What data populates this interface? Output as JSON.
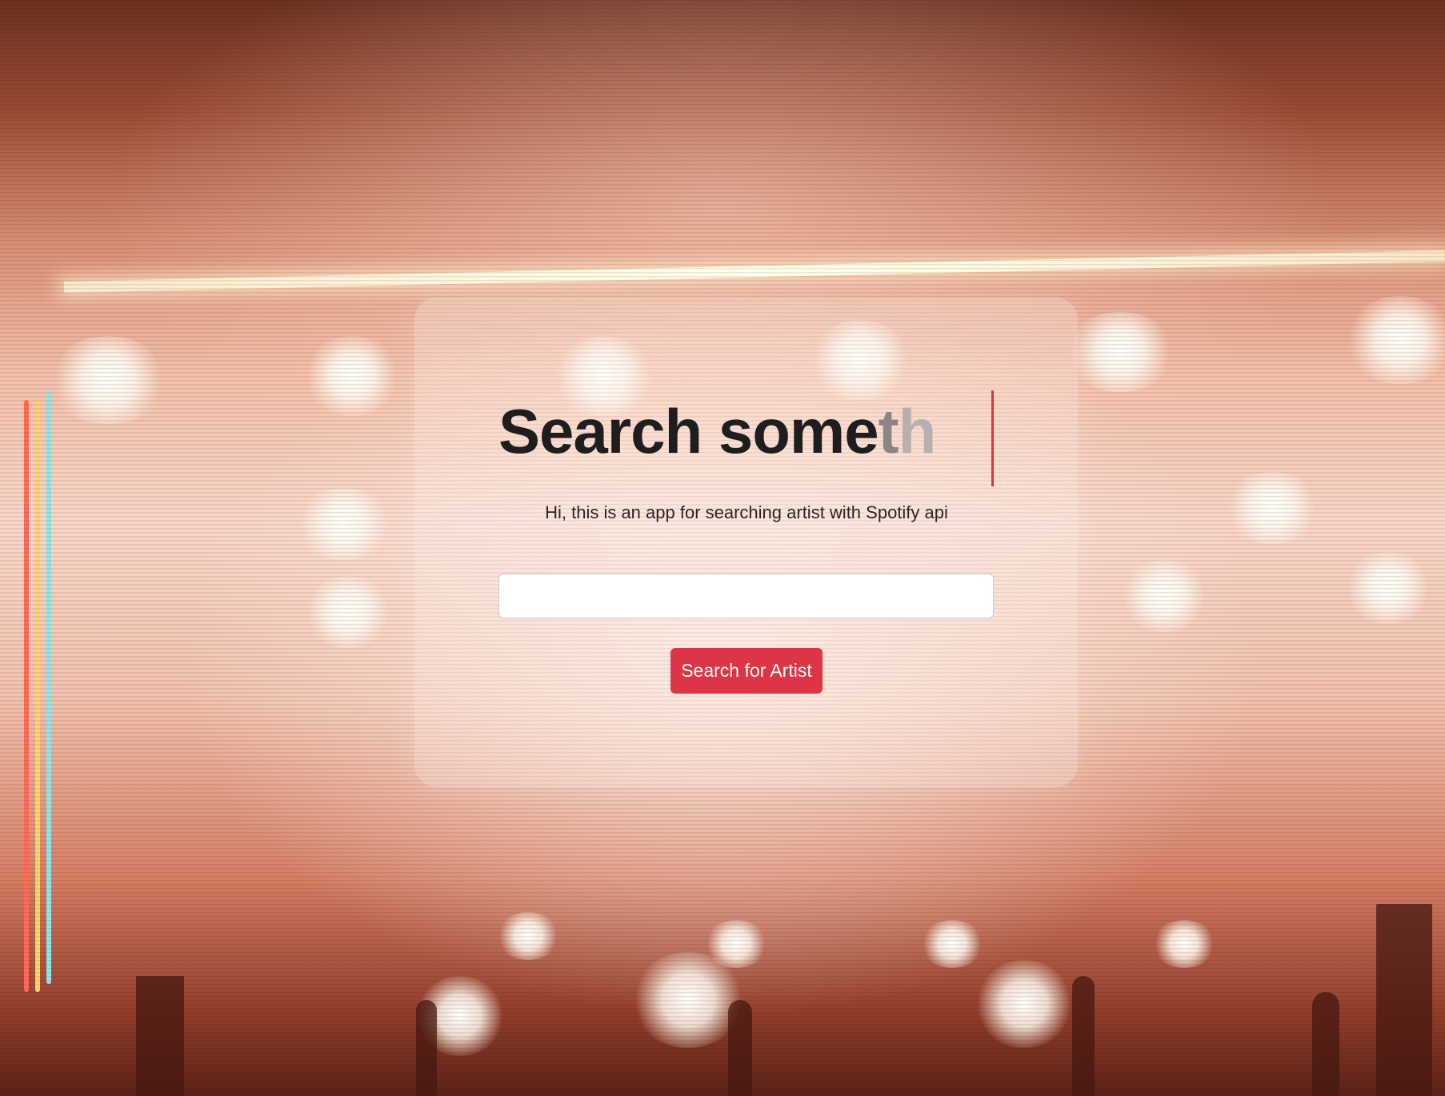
{
  "hero": {
    "headline_solid": "Search some",
    "headline_fade_1": "t",
    "headline_fade_2": "h",
    "subtitle": "Hi, this is an app for searching artist with Spotify api"
  },
  "search": {
    "value": "",
    "placeholder": "",
    "button_label": "Search for Artist"
  },
  "colors": {
    "accent": "#dc3545",
    "text_dark": "#1f1d1d",
    "background_warm": "#f2bfa9"
  }
}
